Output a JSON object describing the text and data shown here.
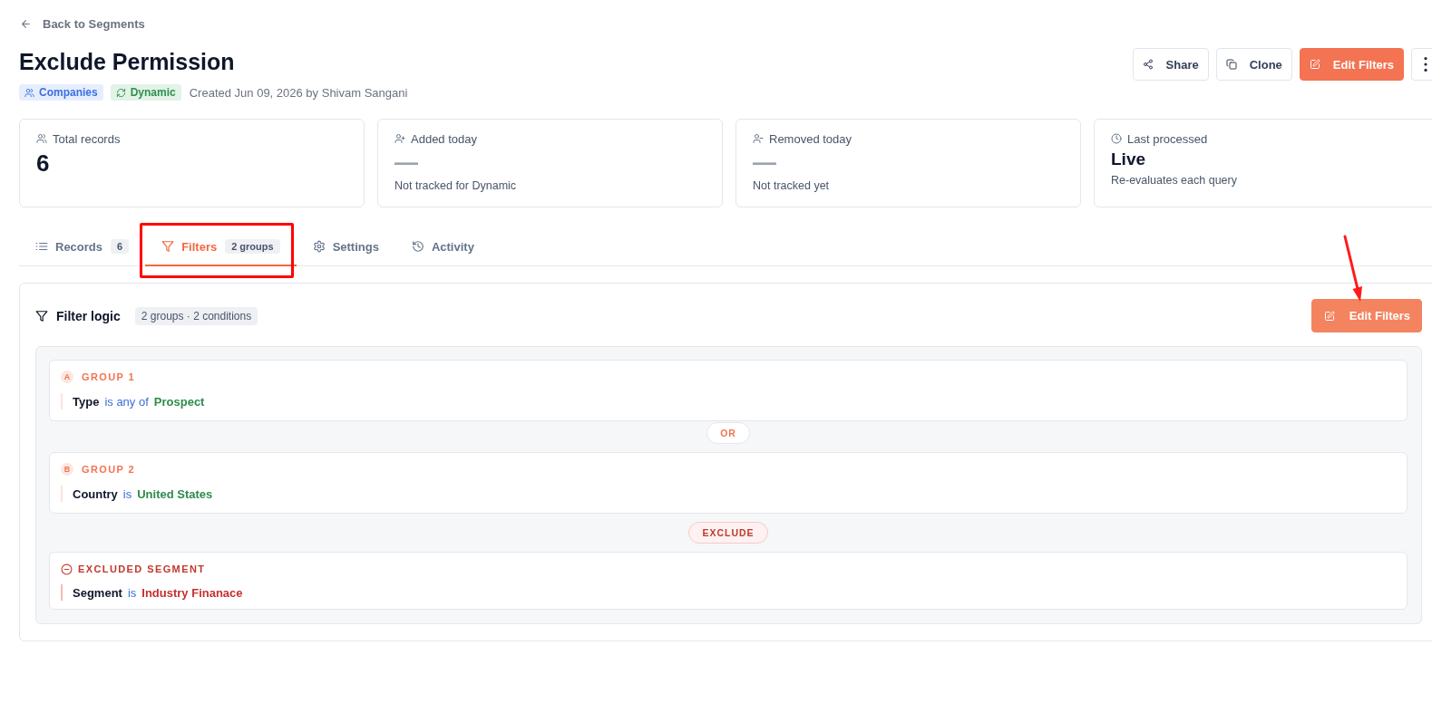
{
  "back_link": {
    "label": "Back to Segments"
  },
  "header": {
    "title": "Exclude Permission",
    "tags": [
      {
        "kind": "entity",
        "label": "Companies"
      },
      {
        "kind": "mode",
        "label": "Dynamic"
      }
    ],
    "created": "Created Jun 09, 2026 by Shivam Sangani",
    "actions": [
      {
        "kind": "share",
        "label": "Share"
      },
      {
        "kind": "clone",
        "label": "Clone"
      },
      {
        "kind": "edit",
        "label": "Edit Filters"
      },
      {
        "kind": "more"
      }
    ]
  },
  "stats": [
    {
      "kind": "total",
      "label": "Total records",
      "value": "6"
    },
    {
      "kind": "added",
      "label": "Added today",
      "value": "—",
      "note": "Not tracked for Dynamic"
    },
    {
      "kind": "removed",
      "label": "Removed today",
      "value": "—",
      "note": "Not tracked yet"
    },
    {
      "kind": "processed",
      "label": "Last processed",
      "value": "Live",
      "note": "Re-evaluates each query"
    }
  ],
  "tabs": [
    {
      "kind": "list",
      "label": "Records",
      "count": "6",
      "selected": false
    },
    {
      "kind": "filter",
      "label": "Filters",
      "count": "2 groups",
      "selected": true
    },
    {
      "kind": "gear",
      "label": "Settings",
      "selected": false
    },
    {
      "kind": "history",
      "label": "Activity",
      "selected": false
    }
  ],
  "filter_panel": {
    "title": "Filter logic",
    "summary": "2 groups · 2 conditions",
    "action": "Edit Filters",
    "items": [
      {
        "kind": "group",
        "letter": "A",
        "title": "GROUP 1",
        "conditions": [
          {
            "field": "Type",
            "operator": "is any of",
            "value": "Prospect"
          }
        ]
      },
      {
        "kind": "or",
        "label": "OR"
      },
      {
        "kind": "group",
        "letter": "B",
        "title": "GROUP 2",
        "conditions": [
          {
            "field": "Country",
            "operator": "is",
            "value": "United States"
          }
        ]
      },
      {
        "kind": "exclude",
        "label": "EXCLUDE"
      },
      {
        "kind": "excluded",
        "title": "EXCLUDED SEGMENT",
        "conditions": [
          {
            "field": "Segment",
            "operator": "is",
            "value": "Industry Finanace"
          }
        ]
      }
    ]
  }
}
